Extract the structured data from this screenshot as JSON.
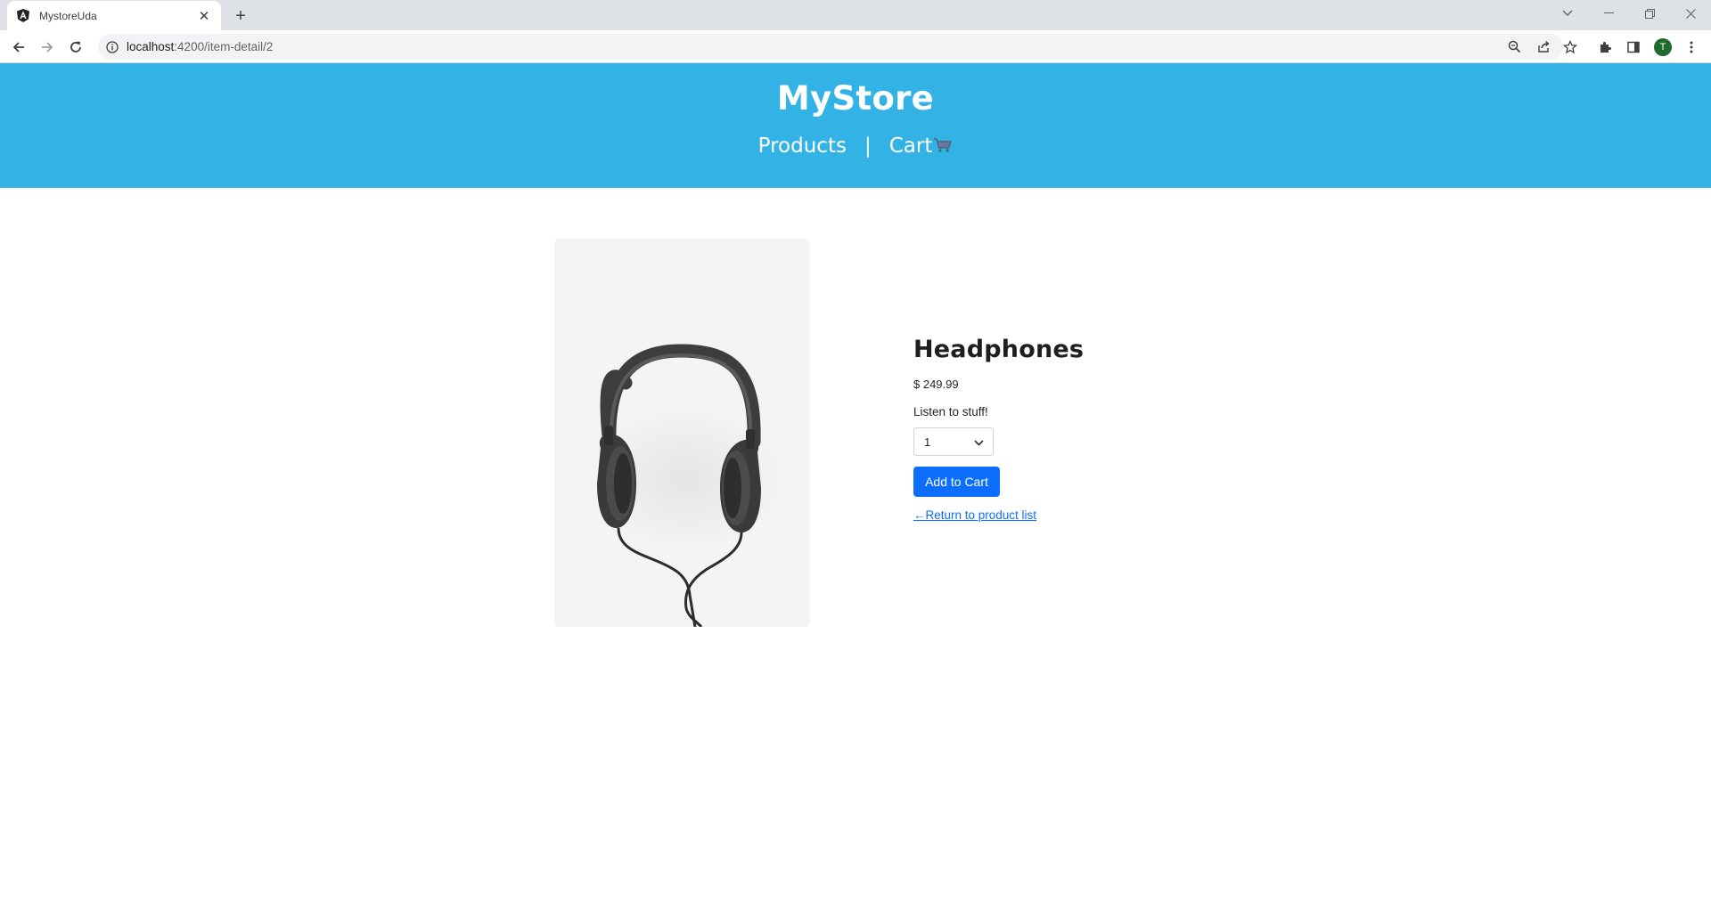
{
  "browser": {
    "tab_title": "MystoreUda",
    "url_host": "localhost",
    "url_path": ":4200/item-detail/2",
    "avatar_letter": "T"
  },
  "header": {
    "brand": "MyStore",
    "nav_products": "Products",
    "nav_separator": "|",
    "nav_cart": "Cart"
  },
  "product": {
    "name": "Headphones",
    "price": "$ 249.99",
    "description": "Listen to stuff!",
    "quantity_selected": "1",
    "add_button": "Add to Cart",
    "return_link": "←Return to product list"
  },
  "colors": {
    "header_bg": "#33b3e5",
    "primary": "#0d6efd",
    "image_bg": "#f3f4f6"
  },
  "icons": [
    "angular-favicon-icon",
    "close-icon",
    "plus-icon",
    "back-icon",
    "forward-icon",
    "reload-icon",
    "info-icon",
    "zoom-icon",
    "share-icon",
    "star-icon",
    "extensions-icon",
    "sidepanel-icon",
    "menu-icon",
    "cart-icon",
    "chevron-down-icon"
  ]
}
